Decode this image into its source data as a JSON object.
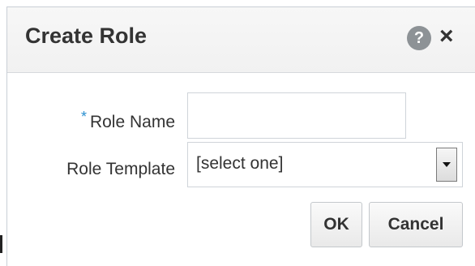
{
  "dialog": {
    "title": "Create Role",
    "help_icon": "help-icon",
    "help_glyph": "?",
    "close_icon": "close-icon",
    "close_glyph": "×"
  },
  "form": {
    "required_marker": "*",
    "role_name_label": "Role Name",
    "role_name_value": "",
    "role_template_label": "Role Template",
    "role_template_selected": "[select one]"
  },
  "buttons": {
    "ok_label": "OK",
    "cancel_label": "Cancel"
  },
  "colors": {
    "required_accent": "#2a8fd0",
    "title_text": "#333333",
    "help_icon_bg": "#8d9296"
  }
}
